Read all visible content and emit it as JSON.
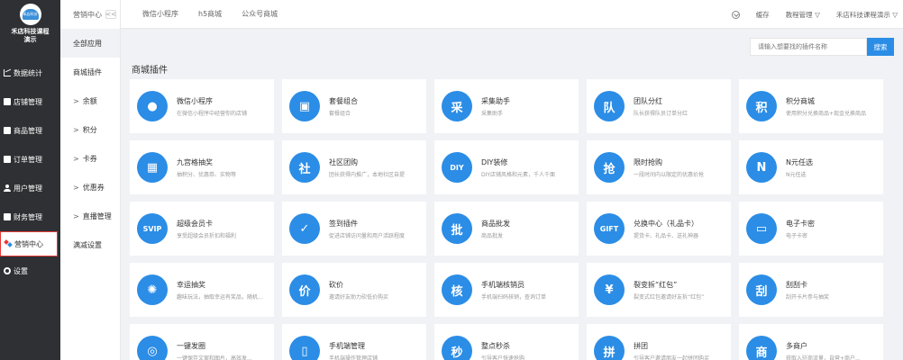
{
  "brand": {
    "logo_text": "禾店科技",
    "name_line1": "禾店科技课程",
    "name_line2": "演示"
  },
  "sidebar": {
    "items": [
      {
        "label": "数据统计",
        "icon": "chart-icon"
      },
      {
        "label": "店铺管理",
        "icon": "store-icon"
      },
      {
        "label": "商品管理",
        "icon": "goods-icon"
      },
      {
        "label": "订单管理",
        "icon": "order-icon"
      },
      {
        "label": "用户管理",
        "icon": "user-icon"
      },
      {
        "label": "财务管理",
        "icon": "finance-icon"
      },
      {
        "label": "营销中心",
        "icon": "marketing-icon",
        "active": true
      },
      {
        "label": "设置",
        "icon": "settings-icon"
      }
    ]
  },
  "subsidebar": {
    "header": "营销中心",
    "collapse": "<<",
    "items": [
      {
        "label": "全部应用",
        "arrow": ""
      },
      {
        "label": "商城插件",
        "arrow": ""
      },
      {
        "label": "余额",
        "arrow": ">"
      },
      {
        "label": "积分",
        "arrow": ">"
      },
      {
        "label": "卡券",
        "arrow": ">"
      },
      {
        "label": "优惠券",
        "arrow": ">"
      },
      {
        "label": "直播管理",
        "arrow": ">"
      },
      {
        "label": "满减设置",
        "arrow": ""
      }
    ]
  },
  "topnav": [
    "微信小程序",
    "h5商城",
    "公众号商城"
  ],
  "topright": {
    "cache": "缓存",
    "admin": "教程管理 ▽",
    "store": "禾店科技课程演示 ▽"
  },
  "search": {
    "placeholder": "请输入想要找的插件名称",
    "button": "搜索"
  },
  "section_title": "商城插件",
  "colors": {
    "accent": "#2b8de6",
    "sidebar_bg": "#2e3033",
    "active_border": "#e53935"
  },
  "plugins": [
    {
      "name": "微信小程序",
      "desc": "在微信小程序中经营你的店铺",
      "icon": "wechat-icon",
      "glyph": "●"
    },
    {
      "name": "套餐组合",
      "desc": "套餐组合",
      "icon": "combo-icon",
      "glyph": "▣"
    },
    {
      "name": "采集助手",
      "desc": "采集助手",
      "icon": "collect-icon",
      "glyph": "采"
    },
    {
      "name": "团队分红",
      "desc": "队长获得队员订单分红",
      "icon": "team-icon",
      "glyph": "队"
    },
    {
      "name": "积分商城",
      "desc": "使用积分兑换商品+现金兑换商品",
      "icon": "points-icon",
      "glyph": "积"
    },
    {
      "name": "九宫格抽奖",
      "desc": "抽积分、优惠券、实物等",
      "icon": "lottery-icon",
      "glyph": "▦"
    },
    {
      "name": "社区团购",
      "desc": "团长获得内推广，本地社区自提",
      "icon": "community-icon",
      "glyph": "社"
    },
    {
      "name": "DIY装修",
      "desc": "DIY店铺风格和元素，千人千面",
      "icon": "diy-icon",
      "glyph": "DIY"
    },
    {
      "name": "限时抢购",
      "desc": "一段时间内以限定的优惠价抢",
      "icon": "flash-sale-icon",
      "glyph": "抢"
    },
    {
      "name": "N元任选",
      "desc": "N元任选",
      "icon": "n-yuan-icon",
      "glyph": "N"
    },
    {
      "name": "超级会员卡",
      "desc": "享受超级会员折扣和福利",
      "icon": "vip-card-icon",
      "glyph": "SVIP"
    },
    {
      "name": "签到插件",
      "desc": "促进店铺访问量和用户活跃程度",
      "icon": "checkin-icon",
      "glyph": "✓"
    },
    {
      "name": "商品批发",
      "desc": "商品批发",
      "icon": "wholesale-icon",
      "glyph": "批"
    },
    {
      "name": "兑换中心（礼品卡）",
      "desc": "提货卡、礼品卡、送礼神器",
      "icon": "gift-card-icon",
      "glyph": "GIFT"
    },
    {
      "name": "电子卡密",
      "desc": "电子卡密",
      "icon": "ecard-icon",
      "glyph": "▭"
    },
    {
      "name": "幸运抽奖",
      "desc": "趣味玩法，抽取幸运有奖品，随机...",
      "icon": "lucky-draw-icon",
      "glyph": "✺"
    },
    {
      "name": "砍价",
      "desc": "邀请好友助力砍低价购买",
      "icon": "bargain-icon",
      "glyph": "价"
    },
    {
      "name": "手机端核销员",
      "desc": "手机端扫码核销，查询订单",
      "icon": "verifier-icon",
      "glyph": "核"
    },
    {
      "name": "裂变拆“红包”",
      "desc": "裂变式红包邀请好友拆“红包”",
      "icon": "red-packet-icon",
      "glyph": "¥"
    },
    {
      "name": "刮刮卡",
      "desc": "刮开卡片参与抽奖",
      "icon": "scratch-icon",
      "glyph": "刮"
    },
    {
      "name": "一键发圈",
      "desc": "一键保存文案和图片，高效发...",
      "icon": "share-icon",
      "glyph": "◎"
    },
    {
      "name": "手机端管理",
      "desc": "手机端操作管理店铺",
      "icon": "mobile-icon",
      "glyph": "▯"
    },
    {
      "name": "整点秒杀",
      "desc": "引导客户快速抢购",
      "icon": "seckill-icon",
      "glyph": "秒"
    },
    {
      "name": "拼团",
      "desc": "引导客户邀请朋友一起拼团购买",
      "icon": "group-buy-icon",
      "glyph": "拼"
    },
    {
      "name": "多商户",
      "desc": "获取入驻商流量，自营+商户...",
      "icon": "multi-store-icon",
      "glyph": "商"
    }
  ]
}
